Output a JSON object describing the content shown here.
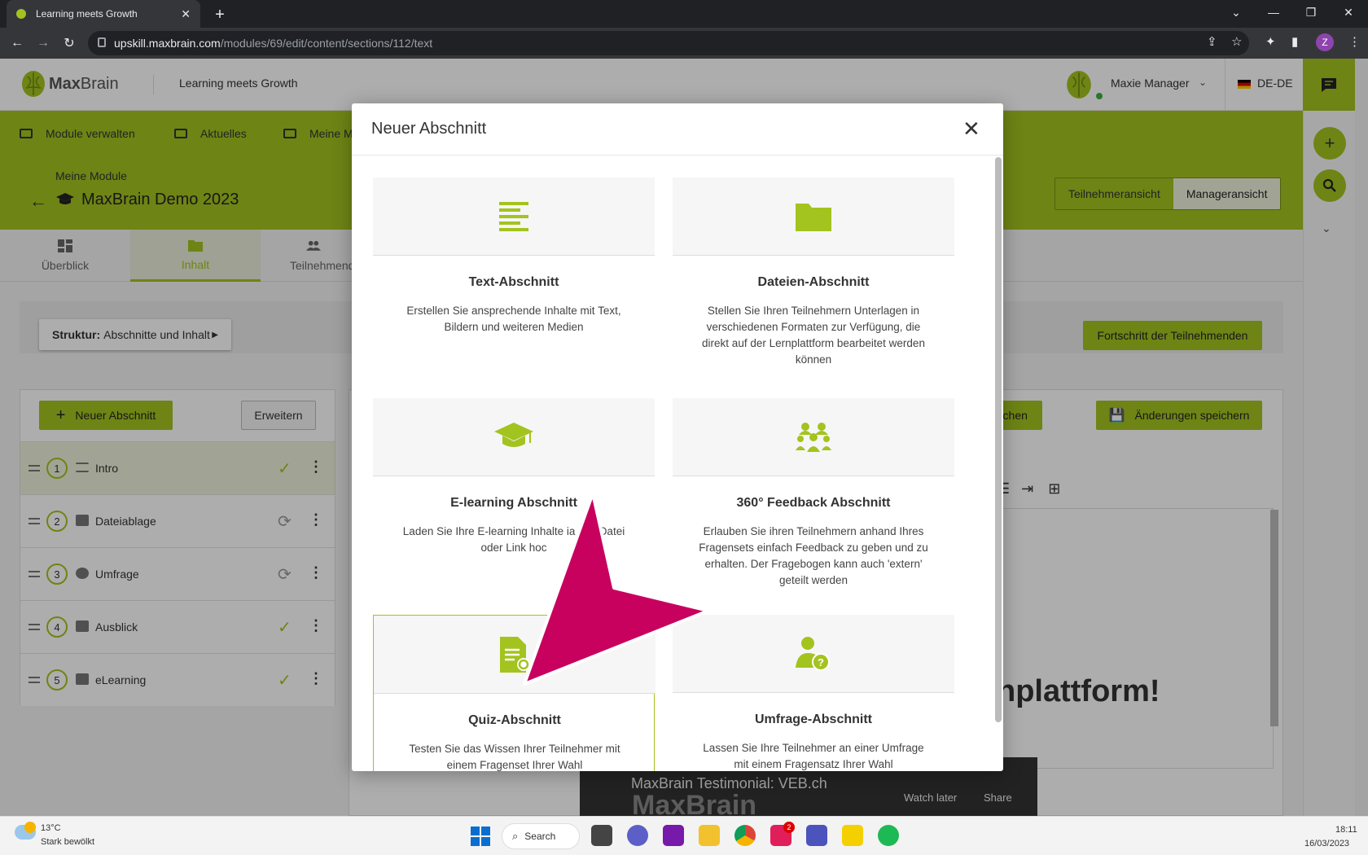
{
  "browser": {
    "tab_title": "Learning meets Growth",
    "new_tab": "+",
    "close_tab": "✕",
    "url_host": "upskill.maxbrain.com",
    "url_path": "/modules/69/edit/content/sections/112/text",
    "profile_initial": "Z"
  },
  "header": {
    "logo_text_bold": "Max",
    "logo_text_light": "Brain",
    "tagline": "Learning meets Growth",
    "user_name": "Maxie Manager",
    "language": "DE-DE"
  },
  "nav": {
    "items": [
      "Module verwalten",
      "Aktuelles",
      "Meine M"
    ]
  },
  "module": {
    "breadcrumb": "Meine Module",
    "title": "MaxBrain Demo 2023",
    "view_participant": "Teilnehmeransicht",
    "view_manager": "Manageransicht"
  },
  "tabs": {
    "overview": "Überblick",
    "content": "Inhalt",
    "participants": "Teilnehmend"
  },
  "structure": {
    "label_bold": "Struktur:",
    "label": "Abschnitte und Inhalt",
    "progress_button": "Fortschritt der Teilnehmenden"
  },
  "sections": {
    "new_button": "Neuer Abschnitt",
    "expand_button": "Erweitern",
    "items": [
      {
        "num": "1",
        "label": "Intro",
        "status": "ok"
      },
      {
        "num": "2",
        "label": "Dateiablage",
        "status": "sync"
      },
      {
        "num": "3",
        "label": "Umfrage",
        "status": "sync"
      },
      {
        "num": "4",
        "label": "Ausblick",
        "status": "ok"
      },
      {
        "num": "5",
        "label": "eLearning",
        "status": "ok"
      }
    ]
  },
  "editor": {
    "publish_button": "eröffentlichen",
    "save_button": "Änderungen speichern",
    "heading_fragment": "nplattform!",
    "video_title": "MaxBrain Testimonial: VEB.ch",
    "video_watch_later": "Watch later",
    "video_share": "Share",
    "video_brand": "MaxBrain"
  },
  "modal": {
    "title": "Neuer Abschnitt",
    "cards": [
      {
        "title": "Text-Abschnitt",
        "desc": "Erstellen Sie ansprechende Inhalte mit Text, Bildern und weiteren Medien",
        "icon": "text-lines-icon"
      },
      {
        "title": "Dateien-Abschnitt",
        "desc": "Stellen Sie Ihren Teilnehmern Unterlagen in verschiedenen Formaten zur Verfügung, die direkt auf der Lernplattform bearbeitet werden können",
        "icon": "folder-icon"
      },
      {
        "title": "E-learning Abschnitt",
        "desc": "Laden Sie Ihre E-learning Inhalte ia ZIP-Datei oder Link hoc",
        "icon": "graduation-cap-icon"
      },
      {
        "title": "360° Feedback Abschnitt",
        "desc": "Erlauben Sie ihren Teilnehmern anhand Ihres Fragensets einfach Feedback zu geben und zu erhalten. Der Fragebogen kann auch 'extern' geteilt werden",
        "icon": "group-icon"
      },
      {
        "title": "Quiz-Abschnitt",
        "desc": "Testen Sie das Wissen Ihrer Teilnehmer mit einem Fragenset Ihrer Wahl",
        "icon": "quiz-document-icon"
      },
      {
        "title": "Umfrage-Abschnitt",
        "desc": "Lassen Sie Ihre Teilnehmer an einer Umfrage mit einem Fragensatz Ihrer Wahl",
        "icon": "survey-person-icon"
      }
    ]
  },
  "taskbar": {
    "temperature": "13°C",
    "condition": "Stark bewölkt",
    "search": "Search",
    "time": "18:11",
    "date": "16/03/2023",
    "slack_badge": "2"
  },
  "colors": {
    "brand_green": "#a3c31f",
    "arrow_magenta": "#c8005e"
  }
}
